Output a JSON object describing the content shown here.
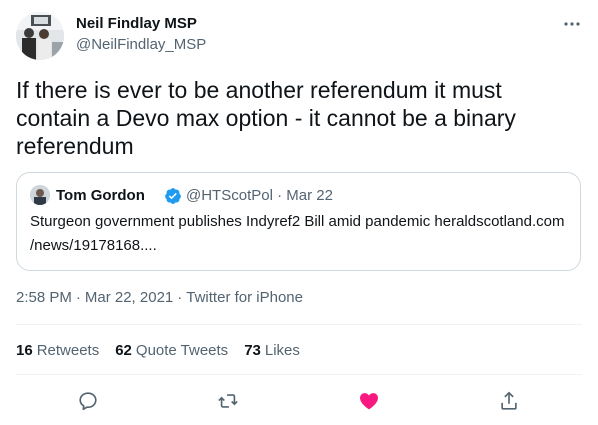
{
  "author": {
    "name": "Neil Findlay MSP",
    "handle": "@NeilFindlay_MSP"
  },
  "tweet": {
    "text": "If there is ever to be another referendum it must contain a Devo max option - it cannot be a binary referendum"
  },
  "quote": {
    "author_name": "Tom Gordon",
    "handle_date": "@HTScotPol · Mar 22",
    "text_line1": "Sturgeon government publishes Indyref2 Bill amid pandemic heraldscotland.com",
    "text_line2": "/news/19178168...."
  },
  "meta": {
    "time": "2:58 PM",
    "date": "Mar 22, 2021",
    "source": "Twitter for iPhone",
    "separator": "·"
  },
  "stats": {
    "retweets_count": "16",
    "retweets_label": "Retweets",
    "quotes_count": "62",
    "quotes_label": "Quote Tweets",
    "likes_count": "73",
    "likes_label": "Likes"
  },
  "colors": {
    "text_primary": "#0f1419",
    "text_secondary": "#536471",
    "border": "#cfd9de",
    "divider": "#eff3f4",
    "verified_blue": "#1d9bf0",
    "like_red": "#f91880"
  },
  "icons": {
    "more": "more-horizontal-icon",
    "verified": "verified-badge-icon",
    "reply": "reply-icon",
    "retweet": "retweet-icon",
    "like": "heart-filled-icon",
    "share": "share-icon"
  }
}
